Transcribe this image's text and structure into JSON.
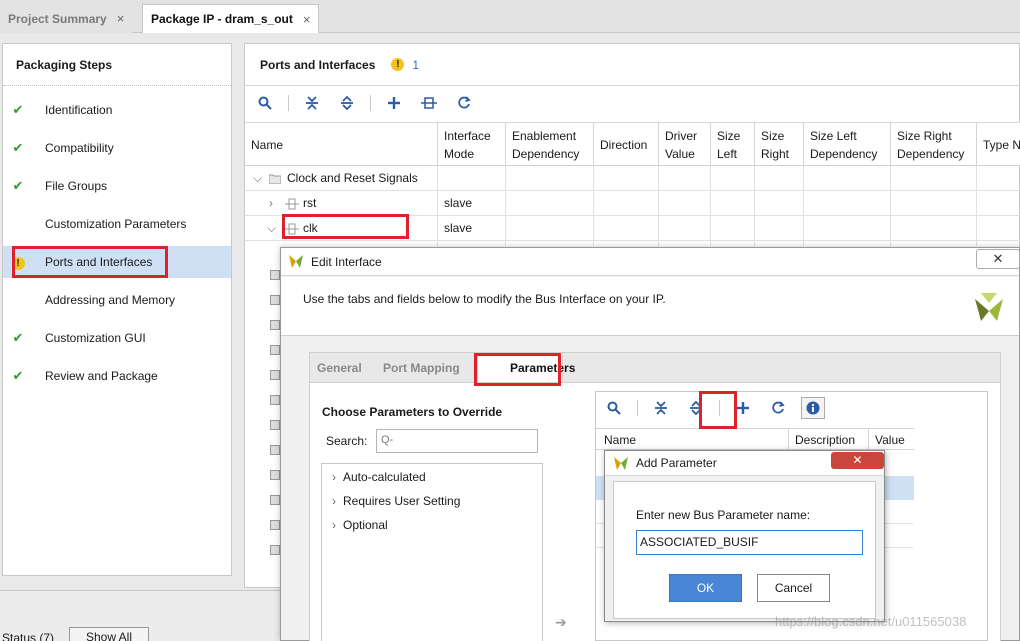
{
  "tabs": [
    {
      "label": "Project Summary",
      "close": "×"
    },
    {
      "label": "Package IP - dram_s_out",
      "close": "×"
    }
  ],
  "packaging": {
    "title": "Packaging Steps",
    "steps": [
      {
        "label": "Identification",
        "status": "done"
      },
      {
        "label": "Compatibility",
        "status": "done"
      },
      {
        "label": "File Groups",
        "status": "done"
      },
      {
        "label": "Customization Parameters",
        "status": "none"
      },
      {
        "label": "Ports and Interfaces",
        "status": "warning",
        "selected": true
      },
      {
        "label": "Addressing and Memory",
        "status": "none"
      },
      {
        "label": "Customization GUI",
        "status": "done"
      },
      {
        "label": "Review and Package",
        "status": "done"
      }
    ]
  },
  "ports": {
    "title": "Ports and Interfaces",
    "warning_count": "1",
    "columns": [
      {
        "label": "Name"
      },
      {
        "label": "Interface Mode"
      },
      {
        "label": "Enablement Dependency"
      },
      {
        "label": "Direction"
      },
      {
        "label": "Driver Value"
      },
      {
        "label": "Size Left"
      },
      {
        "label": "Size Right"
      },
      {
        "label": "Size Left Dependency"
      },
      {
        "label": "Size Right Dependency"
      },
      {
        "label": "Type N"
      }
    ],
    "rows": [
      {
        "name": "Clock and Reset Signals",
        "mode": ""
      },
      {
        "name": "rst",
        "mode": "slave"
      },
      {
        "name": "clk",
        "mode": "slave"
      }
    ]
  },
  "edit_interface": {
    "title": "Edit Interface",
    "close": "✕",
    "description": "Use the tabs and fields below to modify the Bus Interface on your IP.",
    "tabs": [
      "General",
      "Port Mapping",
      "Parameters"
    ],
    "choose_title": "Choose Parameters to Override",
    "search_label": "Search:",
    "search_placeholder": "Q-",
    "tree_items": [
      "Auto-calculated",
      "Requires User Setting",
      "Optional"
    ],
    "table_columns": [
      "Name",
      "Description",
      "Value"
    ]
  },
  "add_parameter": {
    "title": "Add Parameter",
    "close": "✕",
    "label": "Enter new Bus Parameter name:",
    "value": "ASSOCIATED_BUSIF",
    "ok": "OK",
    "cancel": "Cancel"
  },
  "status": {
    "label": "Status (7)",
    "show_all": "Show All"
  },
  "watermark": "https://blog.csdn.net/u011565038",
  "colors": {
    "highlight": "#e0202c",
    "check": "#2e9b2e",
    "warning": "#f3c21b",
    "selection": "#cfe0f5",
    "ok_button": "#4a86d6"
  }
}
